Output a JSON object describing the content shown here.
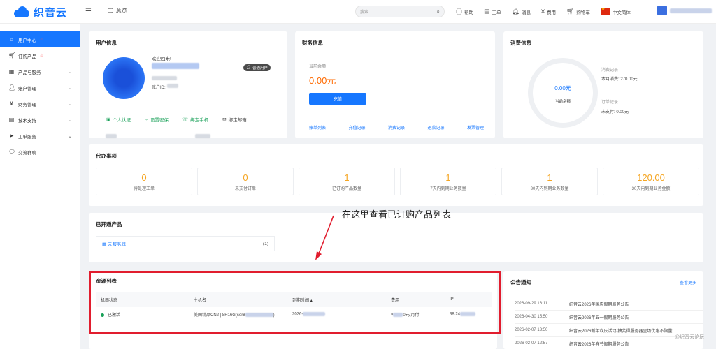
{
  "brand": {
    "name": "织音云"
  },
  "header": {
    "overview": "总览",
    "search_placeholder": "搜索",
    "nav": [
      {
        "label": "帮助",
        "icon": "help-circle-icon"
      },
      {
        "label": "工单",
        "icon": "ticket-icon"
      },
      {
        "label": "消息",
        "icon": "bell-icon"
      },
      {
        "label": "费用",
        "icon": "yuan-circle-icon"
      },
      {
        "label": "购物车",
        "icon": "cart-icon"
      }
    ],
    "language": "中文简体"
  },
  "sidebar": {
    "items": [
      {
        "label": "用户中心",
        "active": true,
        "hot": true
      },
      {
        "label": "订购产品",
        "hot": true
      },
      {
        "label": "产品与服务",
        "expandable": true
      },
      {
        "label": "账户管理",
        "expandable": true
      },
      {
        "label": "财务管理",
        "expandable": true
      },
      {
        "label": "技术支持",
        "expandable": true
      },
      {
        "label": "工单服务",
        "expandable": true
      },
      {
        "label": "交流群聊"
      }
    ]
  },
  "user_card": {
    "title": "用户信息",
    "welcome": "欢迎回来!",
    "badge": "普通用户",
    "uid_label": "账户ID:",
    "verifications": [
      {
        "label": "个人认证",
        "state": "done"
      },
      {
        "label": "设置密保",
        "state": "done"
      },
      {
        "label": "绑定手机",
        "state": "done"
      },
      {
        "label": "绑定邮箱",
        "state": "pending"
      }
    ]
  },
  "finance_card": {
    "title": "财务信息",
    "balance_label": "当前余额",
    "balance": "0.00元",
    "recharge": "充值",
    "links": [
      "账单列表",
      "充值记录",
      "消费记录",
      "退款记录",
      "发票管理"
    ]
  },
  "consumption_card": {
    "title": "消费信息",
    "ring_value": "0.00元",
    "ring_label": "当前余额",
    "consume_title": "消费记录",
    "consume_month": "本月消费: 270.00元",
    "order_title": "订单记录",
    "order_unpaid": "未支付: 0.00元"
  },
  "todo_card": {
    "title": "代办事项",
    "items": [
      {
        "value": "0",
        "label": "待处理工单"
      },
      {
        "value": "0",
        "label": "未支付订单"
      },
      {
        "value": "1",
        "label": "已订购产品数量"
      },
      {
        "value": "1",
        "label": "7天内到期业务数量"
      },
      {
        "value": "1",
        "label": "30天内到期业务数量"
      },
      {
        "value": "120.00",
        "label": "30天内到期业务金额"
      }
    ]
  },
  "products_card": {
    "title": "已开通产品",
    "item": "云服务器",
    "count": "(1)"
  },
  "annotation": "在这里查看已订购产品列表",
  "resource_card": {
    "title": "资源列表",
    "columns": [
      "机器状态",
      "主机名",
      "到期时间",
      "费用",
      "IP"
    ],
    "row": {
      "status": "已激活",
      "host": "美国精品CN2 | 8H16G(ser8",
      "expire": "2026-",
      "fee": "¥",
      "fee_suffix": "0元/月付",
      "ip": "38.24"
    }
  },
  "notice_card": {
    "title": "公告通知",
    "more": "查看更多",
    "items": [
      {
        "date": "2026-09-29 16:11",
        "text": "织音云2026年国庆假期服务公告"
      },
      {
        "date": "2026-04-30 15:50",
        "text": "织音云2026年五一假期服务公告"
      },
      {
        "date": "2026-02-07 13:50",
        "text": "织音云2026新年欢庆活动-抽奖得服务器全场优惠不限量!"
      },
      {
        "date": "2026-02-07 12:57",
        "text": "织音云2026年春节假期服务公告"
      }
    ]
  },
  "watermark": "@织音云论坛",
  "colors": {
    "primary": "#1677ff",
    "accent": "#ff6a00",
    "todo": "#f5a623",
    "success": "#18a058",
    "highlight_box": "#e11d2e"
  }
}
